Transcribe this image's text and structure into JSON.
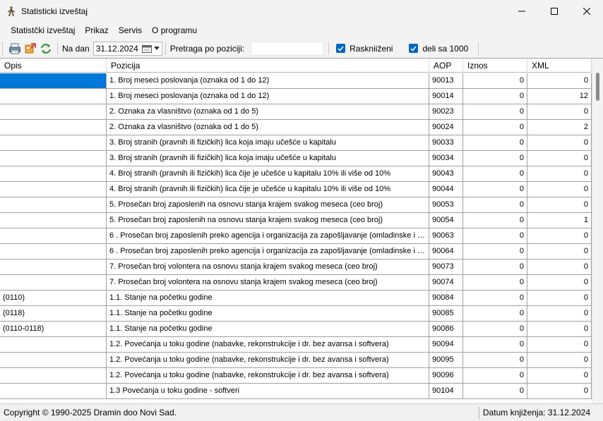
{
  "window": {
    "title": "Statisticki izveštaj",
    "app_icon": "figure-icon"
  },
  "menu": {
    "items": [
      "Statistčki izveštaj",
      "Prikaz",
      "Servis",
      "O programu"
    ]
  },
  "toolbar": {
    "icons": [
      "printer-icon",
      "export-icon",
      "refresh-icon"
    ],
    "date_label": "Na dan",
    "date_value": "31.12.2024",
    "search_label": "Pretraga po poziciji:",
    "search_value": "",
    "raskniizeni_label": "Raskniiženi",
    "raskniizeni_checked": true,
    "deli_label": "deli sa 1000",
    "deli_checked": true
  },
  "grid": {
    "columns": [
      "Opis",
      "Pozicija",
      "AOP",
      "Iznos",
      "XML"
    ],
    "rows": [
      [
        "",
        "1. Broj meseci poslovanja (oznaka od 1 do 12)",
        "90013",
        "0",
        "0"
      ],
      [
        "",
        "1. Broj meseci poslovanja (oznaka od 1 do 12)",
        "90014",
        "0",
        "12"
      ],
      [
        "",
        "2. Oznaka za vlasništvo (oznaka od 1 do 5)",
        "90023",
        "0",
        "0"
      ],
      [
        "",
        "2. Oznaka za vlasništvo (oznaka od 1 do 5)",
        "90024",
        "0",
        "2"
      ],
      [
        "",
        "3. Broj stranih (pravnih ili fizičkih) lica koja imaju učešće u kapitalu",
        "90033",
        "0",
        "0"
      ],
      [
        "",
        "3. Broj stranih (pravnih ili fizičkih) lica koja imaju učešće u kapitalu",
        "90034",
        "0",
        "0"
      ],
      [
        "",
        "4. Broj stranih (pravnih ili fizičkih) lica čije je učešće u kapitalu 10% ili više od 10%",
        "90043",
        "0",
        "0"
      ],
      [
        "",
        "4. Broj stranih (pravnih ili fizičkih) lica čije je učešće u kapitalu 10% ili više od 10%",
        "90044",
        "0",
        "0"
      ],
      [
        "",
        "5. Prosečan broj zaposlenih na osnovu stanja krajem svakog meseca (ceo broj)",
        "90053",
        "0",
        "0"
      ],
      [
        "",
        "5. Prosečan broj zaposlenih na osnovu stanja krajem svakog meseca (ceo broj)",
        "90054",
        "0",
        "1"
      ],
      [
        "",
        "6 . Prosečan broj zaposlenih preko agencija i organizacija za zapošljavanje (omladinske i stud...",
        "90063",
        "0",
        "0"
      ],
      [
        "",
        "6 . Prosečan broj zaposlenih preko agencija i organizacija za zapošljavanje (omladinske i stud...",
        "90064",
        "0",
        "0"
      ],
      [
        "",
        "7. Prosečan broj volontera na osnovu stanja krajem svakog meseca (ceo broj)",
        "90073",
        "0",
        "0"
      ],
      [
        "",
        "7. Prosečan broj volontera na osnovu stanja krajem svakog meseca (ceo broj)",
        "90074",
        "0",
        "0"
      ],
      [
        "(0110)",
        "1.1. Stanje na početku godine",
        "90084",
        "0",
        "0"
      ],
      [
        "(0118)",
        "1.1. Stanje na početku godine",
        "90085",
        "0",
        "0"
      ],
      [
        "(0110-0118)",
        "1.1. Stanje na početku godine",
        "90086",
        "0",
        "0"
      ],
      [
        "",
        "1.2. Povećanja u toku godine (nabavke, rekonstrukcije i dr. bez avansa i softvera)",
        "90094",
        "0",
        "0"
      ],
      [
        "",
        "1.2. Povećanja u toku godine (nabavke, rekonstrukcije i dr. bez avansa i softvera)",
        "90095",
        "0",
        "0"
      ],
      [
        "",
        "1.2. Povećanja u toku godine (nabavke, rekonstrukcije i dr. bez avansa i softvera)",
        "90096",
        "0",
        "0"
      ],
      [
        "",
        "1.3 Povećanja u toku godine - softveri",
        "90104",
        "0",
        "0"
      ]
    ],
    "selected_row": 0
  },
  "status": {
    "copyright": "Copyright © 1990-2025 Dramin doo Novi Sad.",
    "posting_date": "Datum knjiženja: 31.12.2024"
  },
  "colors": {
    "selection": "#0078d7",
    "checkbox": "#0067c0"
  }
}
